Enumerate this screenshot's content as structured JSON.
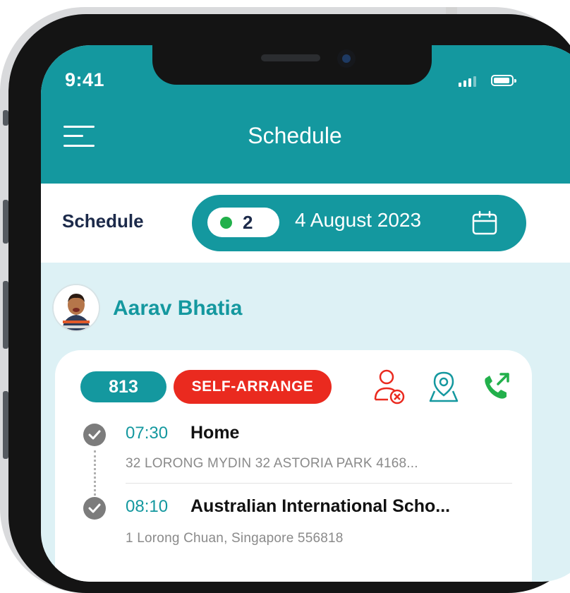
{
  "status_bar": {
    "time": "9:41"
  },
  "header": {
    "title": "Schedule",
    "menu_icon": "menu-icon"
  },
  "schedule_bar": {
    "label": "Schedule",
    "count": "2",
    "count_color": "#22b04b",
    "date": "4 August 2023",
    "calendar_icon": "calendar-icon"
  },
  "student": {
    "name": "Aarav Bhatia"
  },
  "trip": {
    "number": "813",
    "type_badge": "SELF-ARRANGE",
    "actions": [
      "cancel-user-icon",
      "location-icon",
      "phone-call-icon"
    ],
    "stops": [
      {
        "time": "07:30",
        "name": "Home",
        "address": "32 LORONG MYDIN 32 ASTORIA PARK 4168..."
      },
      {
        "time": "08:10",
        "name": "Australian International Scho...",
        "address": "1 Lorong Chuan, Singapore 556818"
      }
    ]
  },
  "colors": {
    "accent": "#14989f",
    "danger": "#ea2a1f",
    "success": "#22b04b",
    "background": "#ddf1f5"
  }
}
